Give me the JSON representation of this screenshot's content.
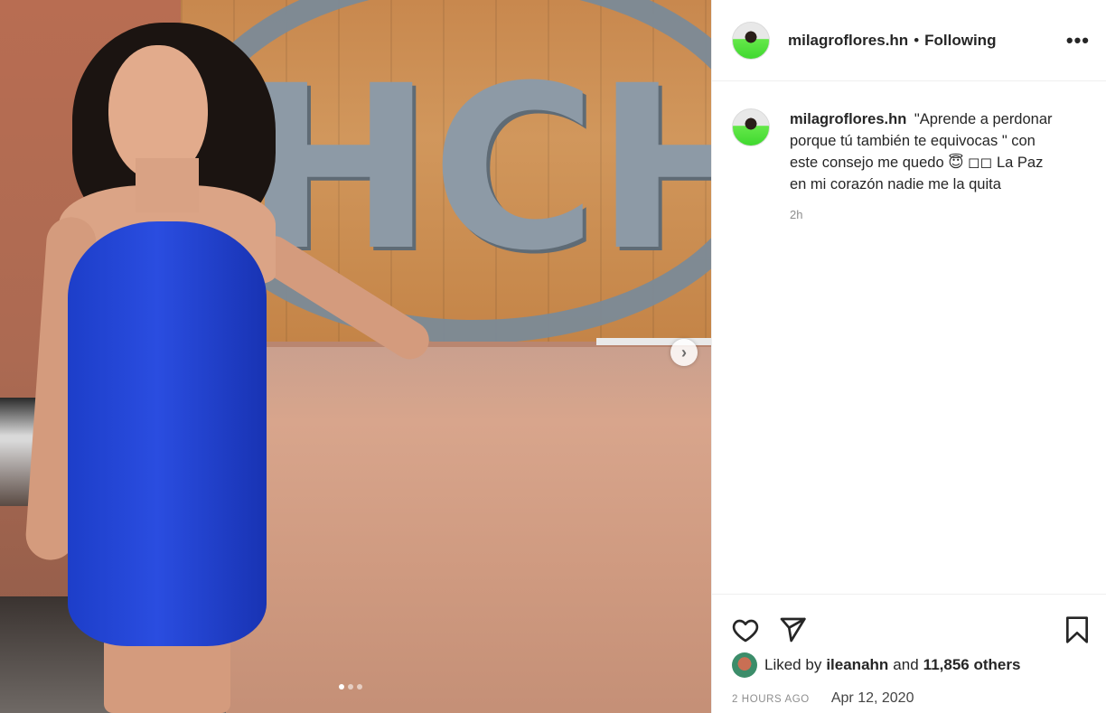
{
  "post": {
    "username": "milagroflores.hn",
    "separator": "•",
    "follow_status": "Following",
    "more_label": "•••",
    "photo_logo_text": "HCH",
    "carousel_next": "›",
    "carousel_dots": 3,
    "carousel_active_index": 0
  },
  "caption": {
    "username": "milagroflores.hn",
    "text": "\"Aprende a perdonar porque tú también te equivocas \" con este consejo me quedo 😇 ◻◻ La Paz en mi corazón nadie me la quita",
    "time_ago": "2h"
  },
  "actions": {
    "like_icon": "heart-icon",
    "share_icon": "paper-plane-icon",
    "save_icon": "bookmark-icon"
  },
  "likes": {
    "prefix": "Liked by",
    "first_liker": "ileanahn",
    "joiner": "and",
    "others": "11,856 others"
  },
  "dates": {
    "relative": "2 HOURS AGO",
    "absolute": "Apr 12, 2020"
  },
  "colors": {
    "text": "#262626",
    "muted": "#8e8e8e",
    "border": "#efefef"
  }
}
